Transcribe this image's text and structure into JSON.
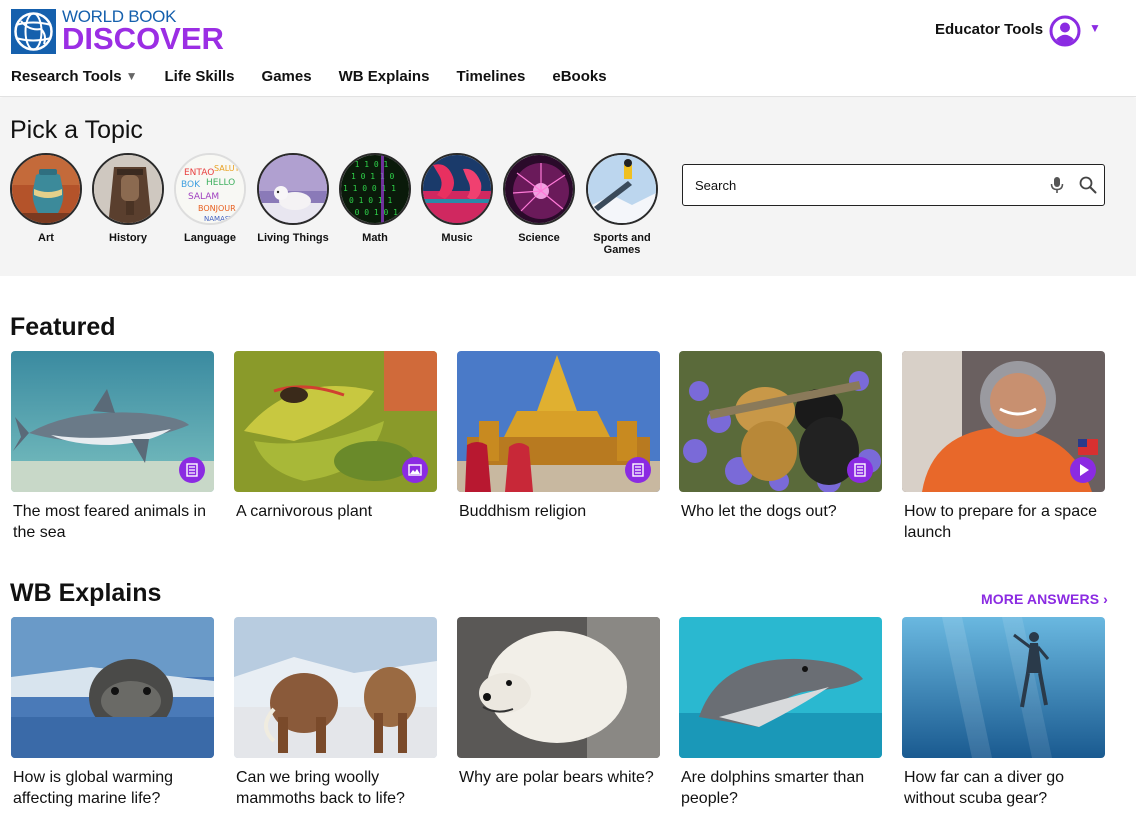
{
  "header": {
    "brand_top": "WORLD BOOK",
    "brand_main": "DISCOVER",
    "educator_tools": "Educator Tools",
    "account_icon": "account-icon",
    "nav": [
      {
        "label": "Research Tools",
        "dropdown": true
      },
      {
        "label": "Life Skills"
      },
      {
        "label": "Games"
      },
      {
        "label": "WB Explains"
      },
      {
        "label": "Timelines"
      },
      {
        "label": "eBooks"
      }
    ]
  },
  "topics": {
    "title": "Pick a Topic",
    "items": [
      {
        "label": "Art"
      },
      {
        "label": "History"
      },
      {
        "label": "Language"
      },
      {
        "label": "Living Things"
      },
      {
        "label": "Math"
      },
      {
        "label": "Music"
      },
      {
        "label": "Science"
      },
      {
        "label": "Sports and Games"
      }
    ]
  },
  "search": {
    "placeholder": "Search",
    "mic_icon": "microphone-icon",
    "search_icon": "search-icon"
  },
  "featured": {
    "title": "Featured",
    "items": [
      {
        "caption": "The most feared animals in the sea",
        "badge": "article-icon"
      },
      {
        "caption": "A carnivorous plant",
        "badge": "image-icon"
      },
      {
        "caption": "Buddhism religion",
        "badge": "article-icon"
      },
      {
        "caption": "Who let the dogs out?",
        "badge": "article-icon"
      },
      {
        "caption": "How to prepare for a space launch",
        "badge": "play-icon"
      }
    ]
  },
  "explains": {
    "title": "WB Explains",
    "more": "MORE ANSWERS ›",
    "items": [
      {
        "caption": "How is global warming affecting marine life?"
      },
      {
        "caption": "Can we bring woolly mammoths back to life?"
      },
      {
        "caption": "Why are polar bears white?"
      },
      {
        "caption": "Are dolphins smarter than people?"
      },
      {
        "caption": "How far can a diver go without scuba gear?"
      }
    ]
  },
  "colors": {
    "brand_purple": "#8b2be2",
    "brand_blue": "#1560ad",
    "topic_bg": "#f4f4f4"
  }
}
